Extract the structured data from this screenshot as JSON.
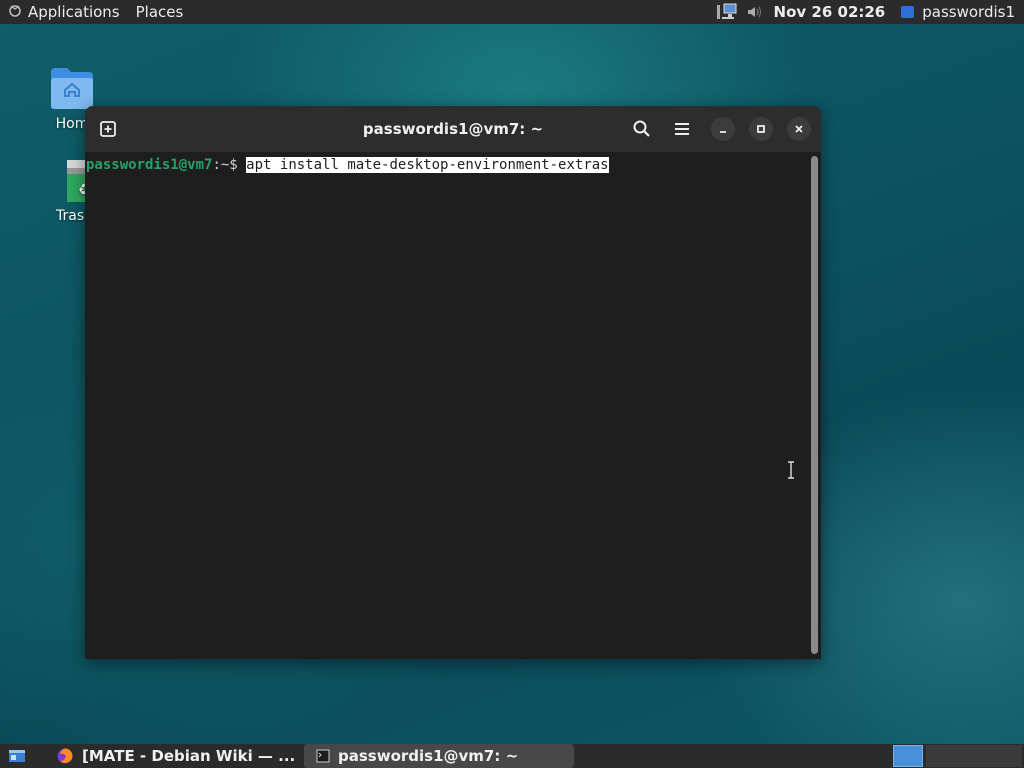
{
  "top_panel": {
    "applications_label": "Applications",
    "places_label": "Places",
    "clock": "Nov 26 02:26",
    "user": "passwordis1"
  },
  "desktop": {
    "home_label": "Hom",
    "trash_label": "Trasl"
  },
  "terminal": {
    "title": "passwordis1@vm7: ~",
    "prompt_user": "passwordis1@vm7",
    "prompt_path": ":~$",
    "command": "apt install mate-desktop-environment-extras"
  },
  "taskbar": {
    "items": [
      {
        "label": "[MATE - Debian Wiki — ...",
        "icon": "firefox-icon"
      },
      {
        "label": "passwordis1@vm7: ~",
        "icon": "terminal-icon"
      }
    ]
  },
  "colors": {
    "prompt_green": "#26a269",
    "panel_bg": "#2b2b2b",
    "user_square": "#2d6fd6",
    "workspace_active": "#4a90d9"
  }
}
